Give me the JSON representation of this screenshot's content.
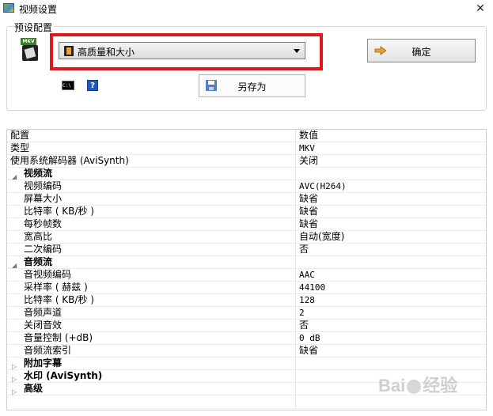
{
  "window": {
    "title": "视频设置",
    "close_glyph": "✕"
  },
  "preset": {
    "group_label": "预设配置",
    "mkv_tag": "MKV",
    "selected": "高质量和大小",
    "ok_label": "确定",
    "save_as_label": "另存为",
    "cmd_glyph": "C:\\",
    "help_glyph": "?"
  },
  "grid": {
    "header": {
      "key": "配置",
      "value": "数值"
    },
    "rows": [
      {
        "key": "类型",
        "value": "MKV"
      },
      {
        "key": "使用系统解码器 (AviSynth)",
        "value": "关闭"
      },
      {
        "key": "视频流",
        "value": ""
      },
      {
        "key": "视频编码",
        "value": "AVC(H264)"
      },
      {
        "key": "屏幕大小",
        "value": "缺省"
      },
      {
        "key": "比特率 ( KB/秒 )",
        "value": "缺省"
      },
      {
        "key": "每秒帧数",
        "value": "缺省"
      },
      {
        "key": "宽高比",
        "value": "自动(宽度)"
      },
      {
        "key": "二次编码",
        "value": "否"
      },
      {
        "key": "音频流",
        "value": ""
      },
      {
        "key": "音视频编码",
        "value": "AAC"
      },
      {
        "key": "采样率 ( 赫兹 )",
        "value": "44100"
      },
      {
        "key": "比特率 ( KB/秒 )",
        "value": "128"
      },
      {
        "key": "音频声道",
        "value": "2"
      },
      {
        "key": "关闭音效",
        "value": "否"
      },
      {
        "key": "音量控制 (+dB)",
        "value": "0 dB"
      },
      {
        "key": "音频流索引",
        "value": "缺省"
      },
      {
        "key": "附加字幕",
        "value": ""
      },
      {
        "key": "水印 (AviSynth)",
        "value": ""
      },
      {
        "key": "高级",
        "value": ""
      }
    ]
  },
  "icons": {
    "expanded": "◢",
    "collapsed": "▷"
  },
  "watermark": {
    "text": "Bai",
    "text2": "经验"
  }
}
